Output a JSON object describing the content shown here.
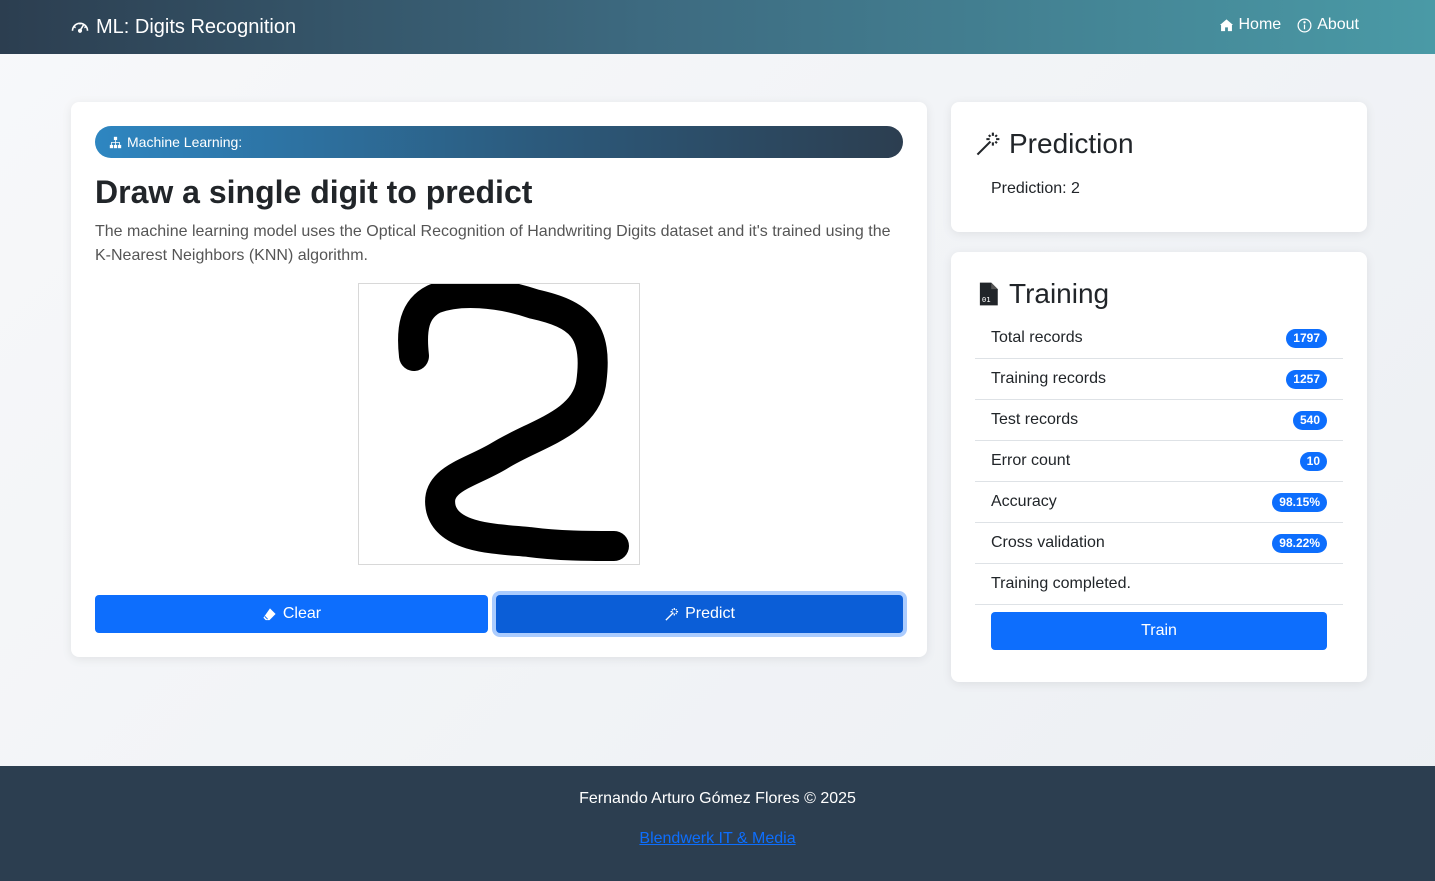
{
  "navbar": {
    "brand": "ML: Digits Recognition",
    "links": [
      {
        "label": "Home",
        "icon": "house-icon"
      },
      {
        "label": "About",
        "icon": "info-circle-icon"
      }
    ]
  },
  "main": {
    "badge": "Machine Learning:",
    "title": "Draw a single digit to predict",
    "description": "The machine learning model uses the Optical Recognition of Handwriting Digits dataset and it's trained using the K-Nearest Neighbors (KNN) algorithm.",
    "clear_label": "Clear",
    "predict_label": "Predict"
  },
  "prediction": {
    "title": "Prediction",
    "text": "Prediction: 2"
  },
  "training": {
    "title": "Training",
    "rows": [
      {
        "label": "Total records",
        "value": "1797"
      },
      {
        "label": "Training records",
        "value": "1257"
      },
      {
        "label": "Test records",
        "value": "540"
      },
      {
        "label": "Error count",
        "value": "10"
      },
      {
        "label": "Accuracy",
        "value": "98.15%"
      },
      {
        "label": "Cross validation",
        "value": "98.22%"
      }
    ],
    "status": "Training completed.",
    "train_label": "Train"
  },
  "footer": {
    "copyright": "Fernando Arturo Gómez Flores © 2025",
    "link": "Blendwerk IT & Media"
  },
  "colors": {
    "primary": "#0d6efd",
    "footer_bg": "#2c3e50"
  }
}
